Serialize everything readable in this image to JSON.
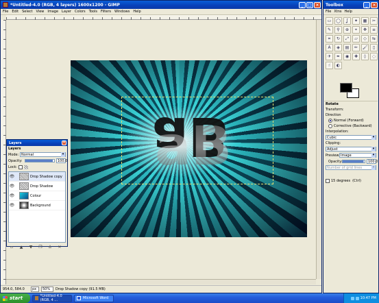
{
  "main_window": {
    "title": "*Untitled-4.0 (RGB, 4 layers) 1600x1200 - GIMP",
    "menu": [
      "File",
      "Edit",
      "Select",
      "View",
      "Image",
      "Layer",
      "Colors",
      "Tools",
      "Filters",
      "Windows",
      "Help"
    ],
    "status": {
      "coordinates": "954.0, 584.0",
      "unit": "px",
      "zoom": "50%",
      "message": "Drop Shadow copy (91.5 MB)"
    }
  },
  "layers_dialog": {
    "title": "Layers",
    "heading": "Layers",
    "mode_label": "Mode:",
    "mode_value": "Normal",
    "opacity_label": "Opacity:",
    "opacity_value": "100.0",
    "opacity_level": 1.0,
    "lock_label": "Lock:",
    "layers": [
      {
        "name": "Drop Shadow copy",
        "visible": true,
        "selected": true,
        "thumb": "texture"
      },
      {
        "name": "Drop Shadow",
        "visible": true,
        "selected": false,
        "thumb": "texture"
      },
      {
        "name": "Colour",
        "visible": true,
        "selected": false,
        "thumb": "cyan"
      },
      {
        "name": "Background",
        "visible": true,
        "selected": false,
        "thumb": "burst"
      }
    ],
    "buttons": [
      "new-layer-icon",
      "raise-icon",
      "lower-icon",
      "duplicate-icon",
      "anchor-icon",
      "delete-icon"
    ]
  },
  "toolbox": {
    "title": "Toolbox",
    "menu": [
      "File",
      "Xtns",
      "Help"
    ],
    "tools": [
      "rect-select",
      "ellipse-select",
      "free-select",
      "fuzzy-select",
      "color-select",
      "scissors",
      "paths",
      "color-picker",
      "zoom",
      "measure",
      "move",
      "align",
      "crop",
      "rotate",
      "scale",
      "shear",
      "perspective",
      "flip",
      "text",
      "bucket-fill",
      "blend",
      "pencil",
      "paintbrush",
      "eraser",
      "airbrush",
      "ink",
      "clone",
      "heal",
      "perspective-clone",
      "convolve",
      "smudge",
      "dodge-burn"
    ],
    "foreground_color": "#000000",
    "background_color": "#ffffff",
    "options": {
      "heading": "Rotate",
      "transform_label": "Transform:",
      "direction_label": "Direction",
      "direction_normal": "Normal (Forward)",
      "direction_corrective": "Corrective (Backward)",
      "interpolation_label": "Interpolation:",
      "interpolation_value": "Cubic",
      "clipping_label": "Clipping:",
      "clipping_value": "Adjust",
      "preview_label": "Preview:",
      "preview_value": "Image",
      "opacity_label": "Opacity:",
      "opacity_value": "100.0",
      "guides_value": "Number of grid lines",
      "degrees_label": "15 degrees",
      "degrees_hint": "(Ctrl)"
    }
  },
  "taskbar": {
    "start_label": "start",
    "tasks": [
      {
        "label": "*Untitled-4.0 (RGB, 4 ...",
        "active": true
      },
      {
        "label": "Microsoft Word",
        "active": false
      }
    ],
    "clock": "10:47 PM"
  }
}
